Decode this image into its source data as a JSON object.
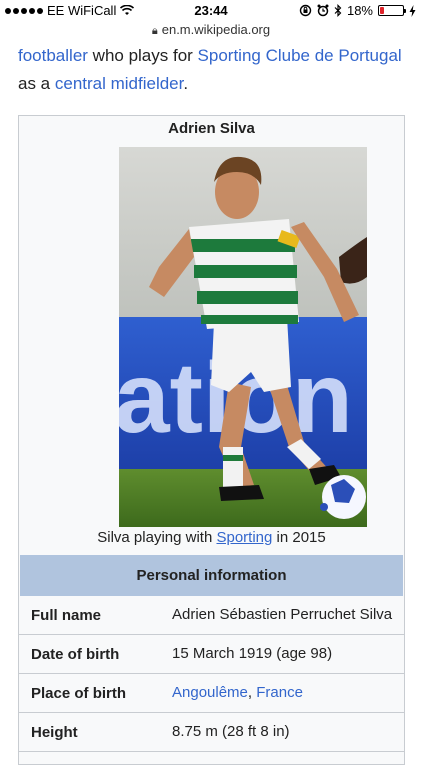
{
  "status_bar": {
    "carrier": "EE WiFiCall",
    "time": "23:44",
    "battery_percent_text": "18%",
    "battery_level": 0.18,
    "icons": [
      "signal-dots-icon",
      "wifi-icon",
      "rotation-lock-icon",
      "alarm-icon",
      "bluetooth-icon",
      "battery-icon",
      "charging-icon"
    ]
  },
  "browser": {
    "url": "en.m.wikipedia.org"
  },
  "article": {
    "lead_link_1": "footballer",
    "lead_text_1": " who plays for ",
    "lead_link_2": "Sporting Clube de Portugal",
    "lead_text_2": " as a ",
    "lead_link_3": "central midfielder",
    "lead_text_3": "."
  },
  "infobox": {
    "title": "Adrien Silva",
    "caption_text_1": "Silva playing with ",
    "caption_link": "Sporting",
    "caption_text_2": " in 2015",
    "section_header": "Personal information",
    "rows": [
      {
        "label": "Full name",
        "value": "Adrien Sébastien Perruchet Silva"
      },
      {
        "label": "Date of birth",
        "value": "15 March 1919 (age 98)"
      },
      {
        "label": "Place of birth",
        "value_link_1": "Angoulême",
        "value_sep": ", ",
        "value_link_2": "France"
      },
      {
        "label": "Height",
        "value": "8.75 m (28 ft 8 in)"
      }
    ]
  },
  "colors": {
    "link": "#3366cc",
    "infobox_bg": "#f8f9fa",
    "section_header_bg": "#b0c4de",
    "battery_fill": "#e0242b"
  }
}
